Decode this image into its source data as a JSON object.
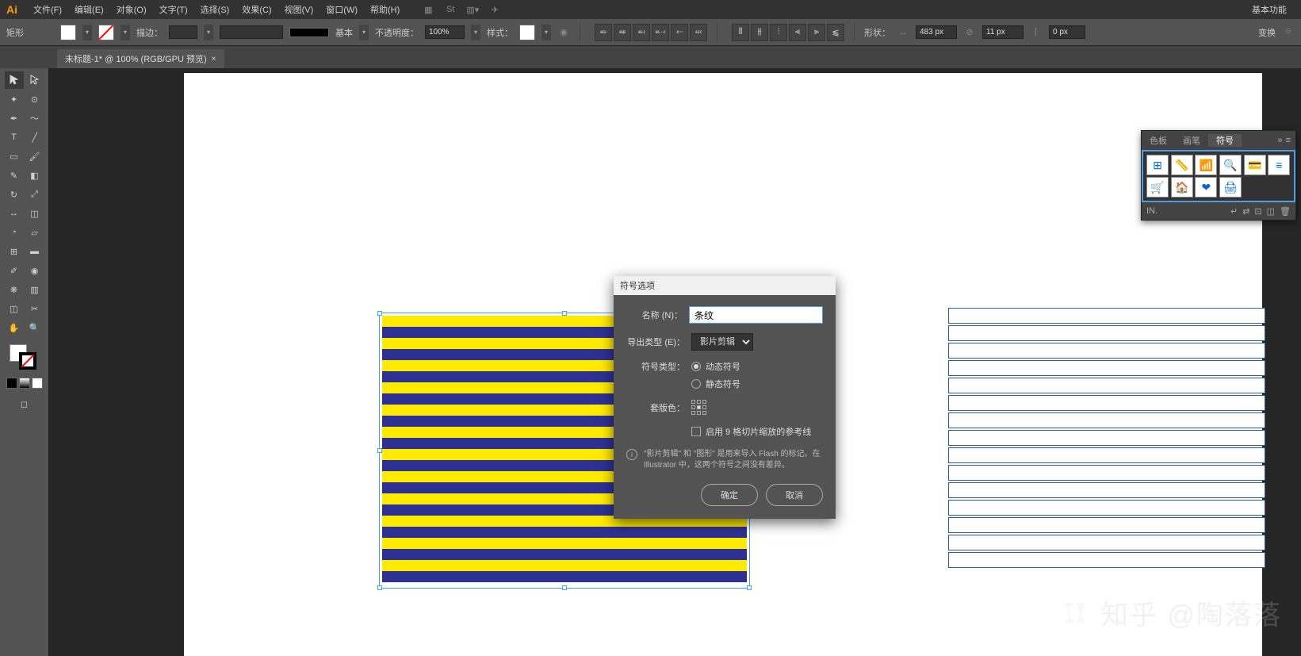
{
  "app_logo": "Ai",
  "menus": [
    "文件(F)",
    "编辑(E)",
    "对象(O)",
    "文字(T)",
    "选择(S)",
    "效果(C)",
    "视图(V)",
    "窗口(W)",
    "帮助(H)"
  ],
  "menu_right": "基本功能",
  "control": {
    "shape_label": "矩形",
    "stroke_label": "描边：",
    "profile_label": "基本",
    "opacity_label": "不透明度：",
    "opacity_value": "100%",
    "style_label": "样式：",
    "shape_label2": "形状：",
    "width_value": "483 px",
    "height_value": "11 px",
    "corner_value": "0 px",
    "transform_label": "变换"
  },
  "document_tab": "未标题-1* @ 100% (RGB/GPU 预览)",
  "symbols_panel": {
    "tabs": [
      "色板",
      "画笔",
      "符号"
    ],
    "footer_label": "IN."
  },
  "dialog": {
    "title": "符号选项",
    "name_label": "名称 (N)：",
    "name_value": "条纹",
    "export_label": "导出类型 (E)：",
    "export_value": "影片剪辑",
    "symtype_label": "符号类型：",
    "radio_dynamic": "动态符号",
    "radio_static": "静态符号",
    "reg_label": "套版色：",
    "guides_label": "启用 9 格切片缩放的参考线",
    "info_text": "\"影片剪辑\" 和 \"图形\" 是用来导入 Flash 的标记。在 Illustrator 中，这两个符号之间没有差异。",
    "ok": "确定",
    "cancel": "取消"
  },
  "watermark": "知乎 @陶落落"
}
